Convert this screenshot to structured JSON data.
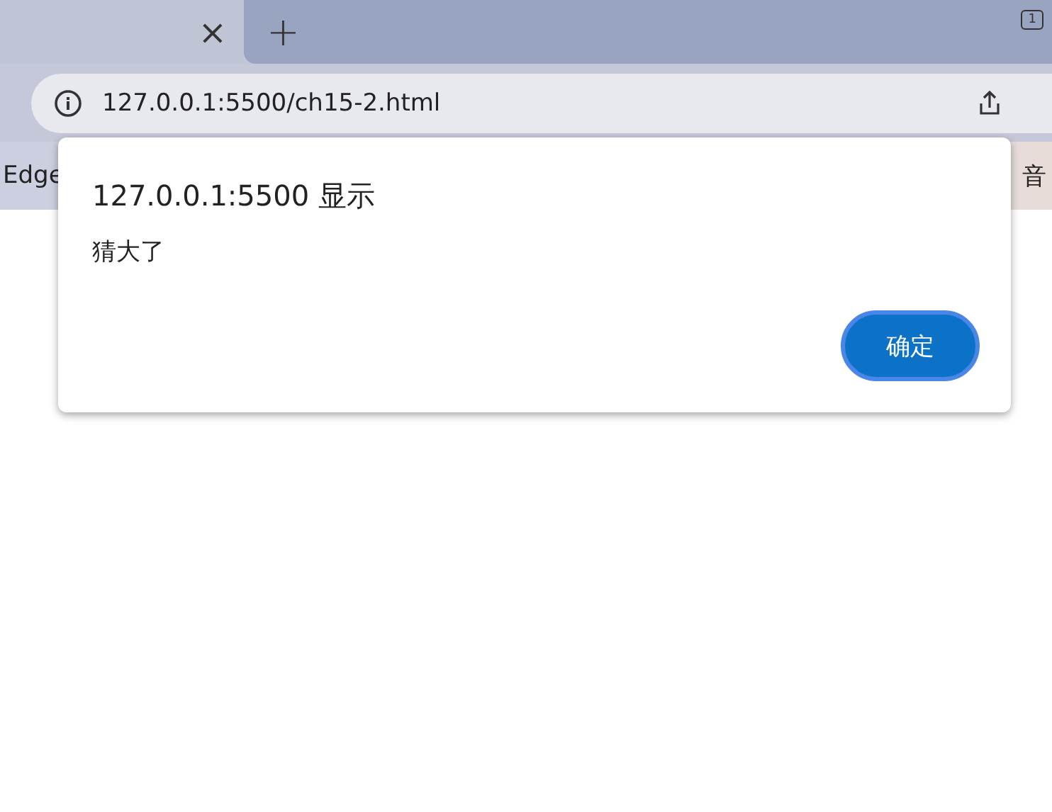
{
  "tab_strip": {
    "close_label": "×",
    "new_tab_label": "+",
    "tab_count": "1"
  },
  "address_bar": {
    "url": "127.0.0.1:5500/ch15-2.html"
  },
  "favorites_bar": {
    "items": [
      "Edge",
      "音"
    ]
  },
  "dialog": {
    "title": "127.0.0.1:5500 显示",
    "message": "猜大了",
    "buttons": [
      "确定"
    ]
  }
}
